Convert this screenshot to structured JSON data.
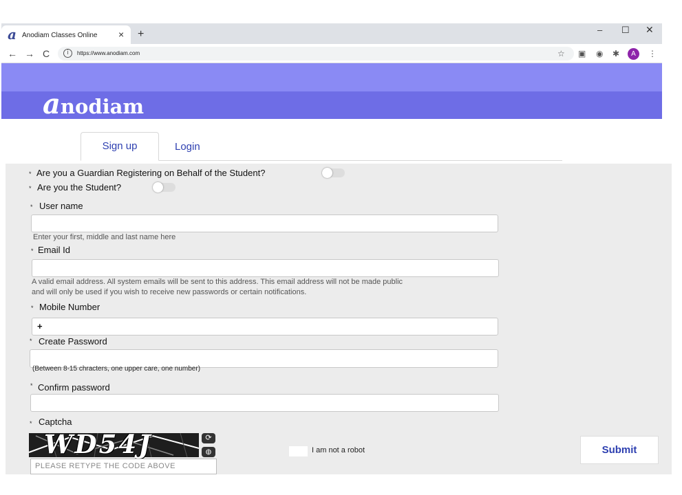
{
  "browser": {
    "tab_title": "Anodiam Classes Online",
    "tab_favicon": "a",
    "tab_close": "×",
    "new_tab": "+",
    "url": "https://www.anodiam.com",
    "window_controls": {
      "minimize": "–",
      "maximize": "☐",
      "close": "✕"
    },
    "nav": {
      "back": "←",
      "forward": "→",
      "reload": "C"
    },
    "info": "i",
    "avatar_letter": "A",
    "menu": "⋮"
  },
  "site": {
    "logo_initial": "a",
    "logo_rest": "nodiam"
  },
  "tabs": {
    "signup": "Sign up",
    "login": "Login"
  },
  "form": {
    "asterisk": "*",
    "guardian_question": "Are you a Guardian Registering on Behalf of the Student?",
    "student_question": "Are you the Student?",
    "username_label": "User name",
    "username_help": "Enter your first, middle and last name here",
    "email_label": "Email Id",
    "email_help_line1": "A valid email address. All system emails will be sent to this address. This email address will not be made public",
    "email_help_line2": "and will only be used if you wish to receive new passwords or certain notifications.",
    "mobile_label": "Mobile Number",
    "mobile_value": "+",
    "password_label": "Create Password",
    "password_help": "(Between 8-15 chracters, one upper care, one number)",
    "confirm_label": "Confirm password",
    "captcha_label": "Captcha",
    "captcha_code": "WD54J",
    "captcha_placeholder": "PLEASE RETYPE THE CODE ABOVE",
    "robot_label": "I am not a robot",
    "submit": "Submit"
  },
  "colors": {
    "banner_light": "#8a8af4",
    "banner_dark": "#6e6de6",
    "accent_text": "#2d3fb0",
    "form_background": "#ececec"
  }
}
